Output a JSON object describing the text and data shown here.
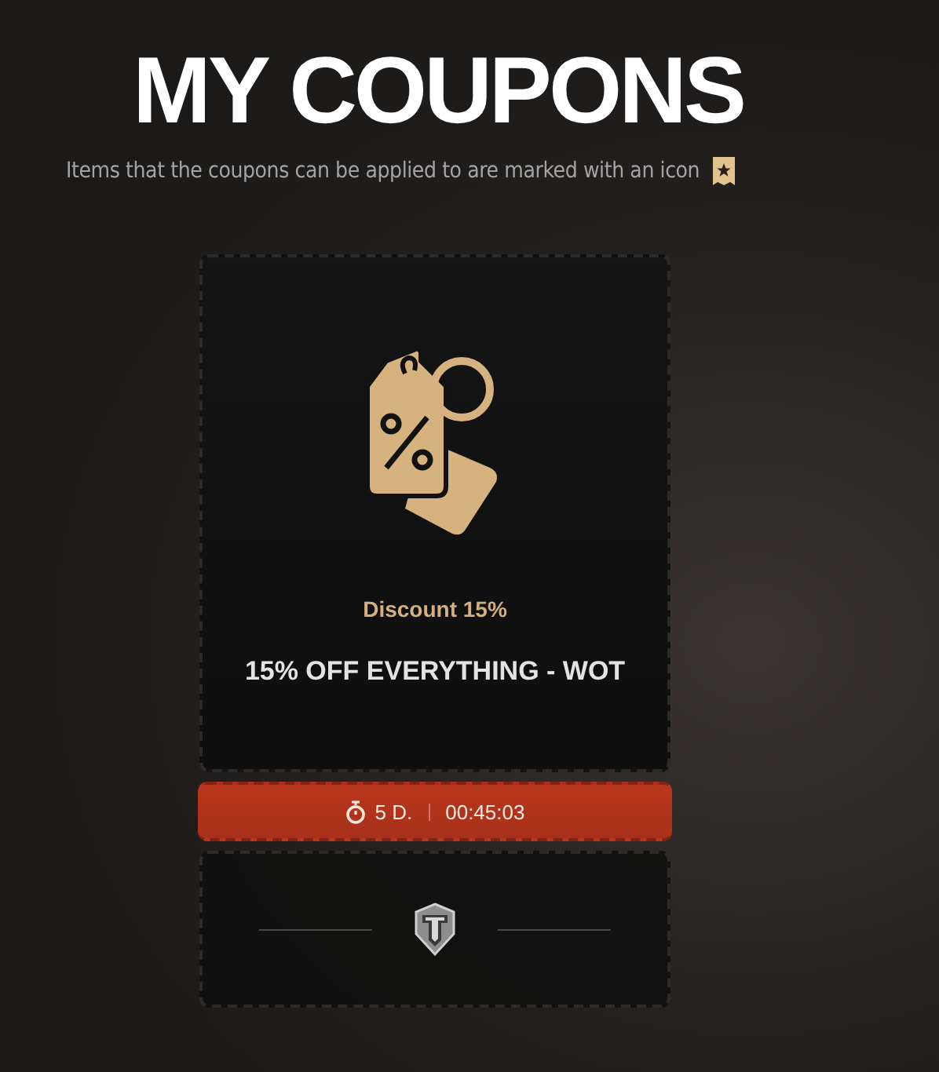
{
  "page": {
    "title": "MY COUPONS",
    "subtitle": "Items that the coupons can be applied to are marked with an icon"
  },
  "coupon": {
    "label": "Discount 15%",
    "name": "15% OFF EVERYTHING - WOT",
    "timer": {
      "days": "5 D.",
      "time": "00:45:03"
    }
  }
}
